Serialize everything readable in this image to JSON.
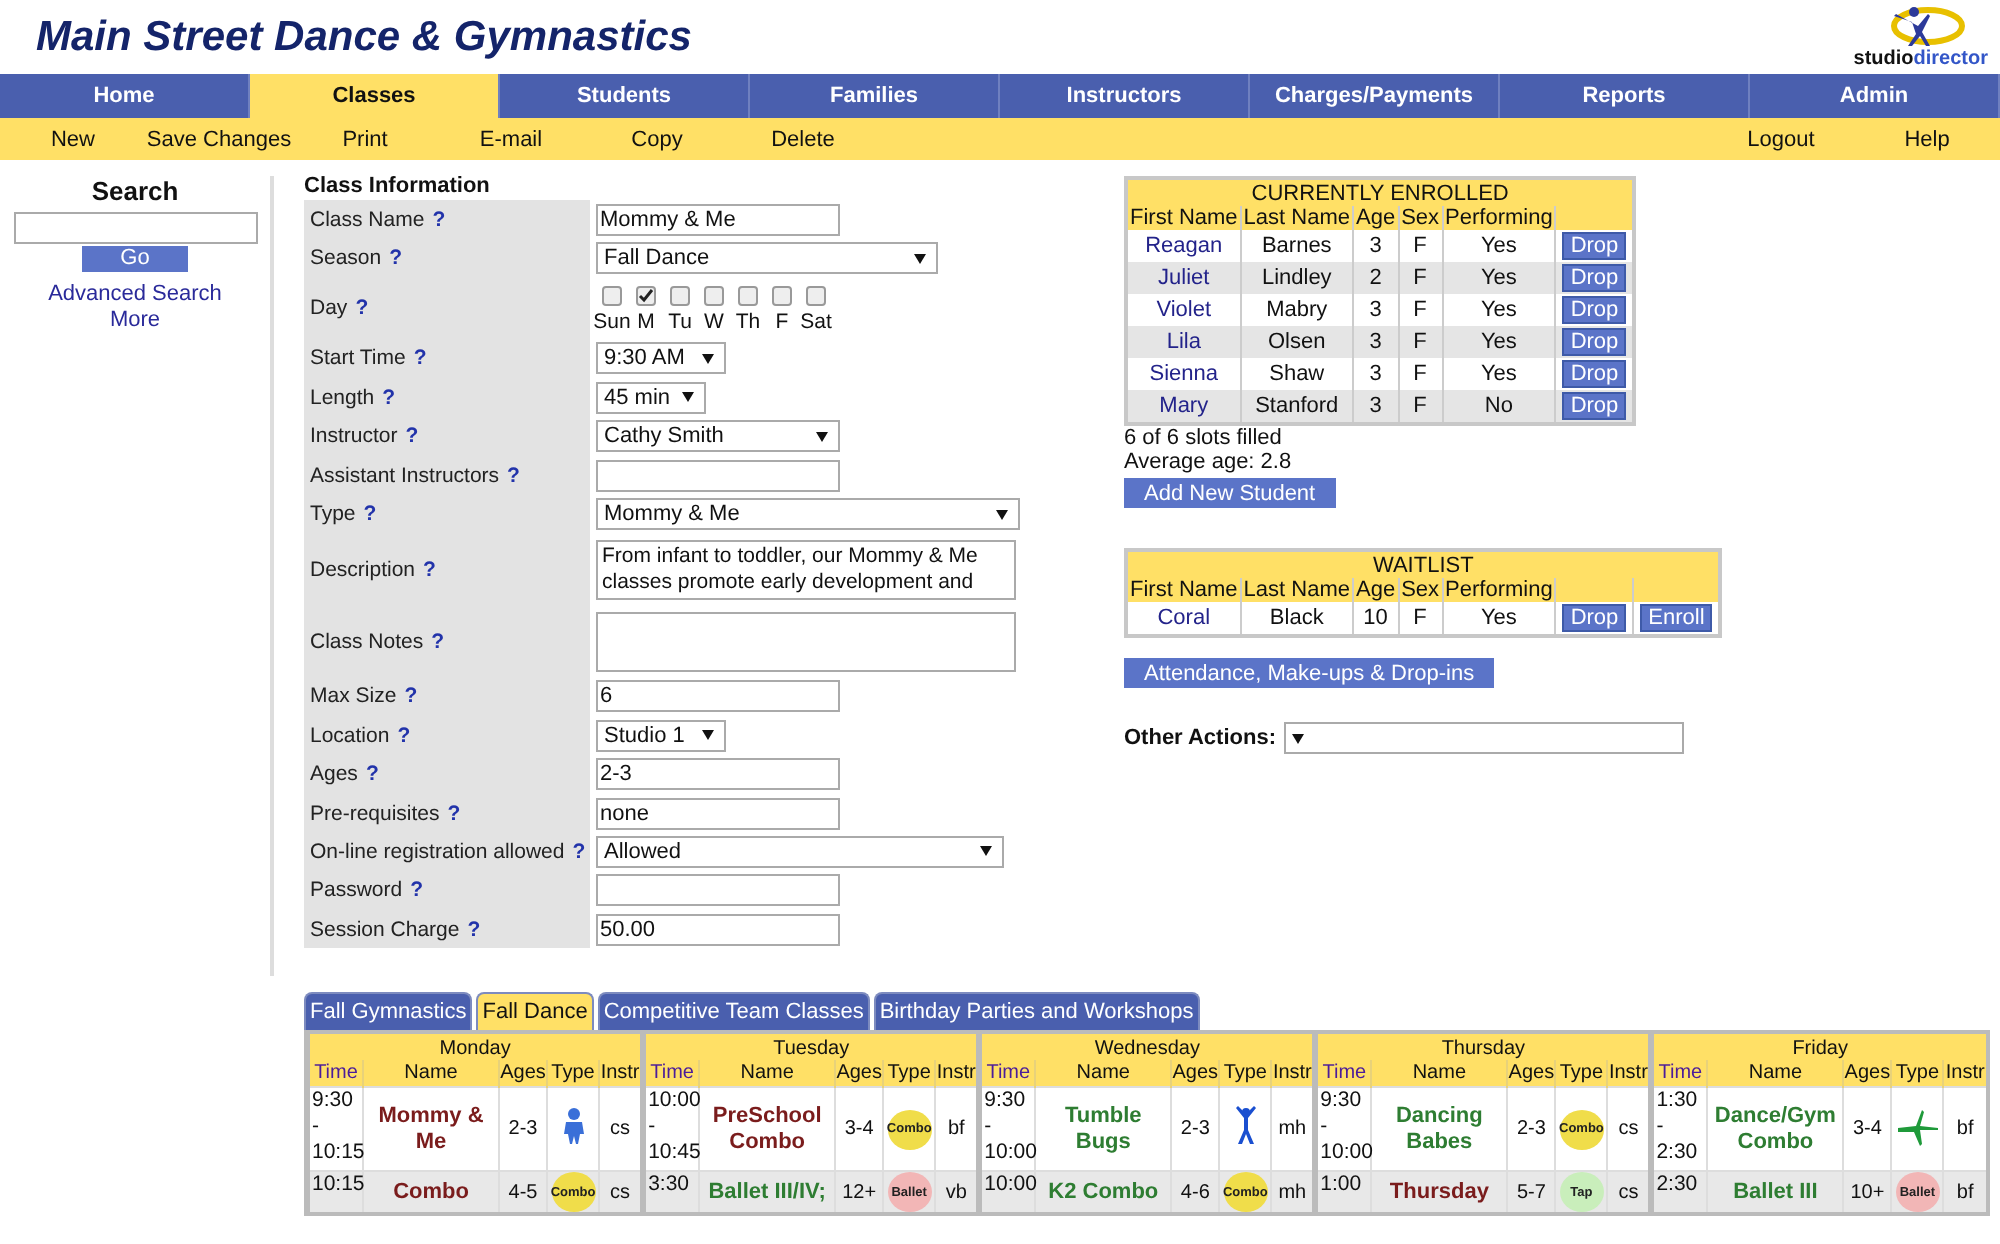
{
  "header": {
    "title": "Main Street Dance & Gymnastics",
    "logo_parts": [
      "studio",
      "director"
    ]
  },
  "nav": [
    {
      "label": "Home",
      "selected": false
    },
    {
      "label": "Classes",
      "selected": true
    },
    {
      "label": "Students",
      "selected": false
    },
    {
      "label": "Families",
      "selected": false
    },
    {
      "label": "Instructors",
      "selected": false
    },
    {
      "label": "Charges/Payments",
      "selected": false
    },
    {
      "label": "Reports",
      "selected": false
    },
    {
      "label": "Admin",
      "selected": false
    }
  ],
  "toolbar": {
    "left": [
      "New",
      "Save Changes",
      "Print",
      "E-mail",
      "Copy",
      "Delete"
    ],
    "right": [
      "Logout",
      "Help"
    ]
  },
  "search": {
    "title": "Search",
    "button": "Go",
    "links": [
      "Advanced Search",
      "More"
    ]
  },
  "class_info": {
    "title": "Class Information",
    "fields": [
      {
        "kind": "text",
        "label": "Class Name",
        "help": "?",
        "value": "Mommy & Me"
      },
      {
        "kind": "select",
        "label": "Season",
        "help": "?",
        "value": "Fall Dance"
      },
      {
        "kind": "days",
        "label": "Day",
        "help": "?",
        "days": [
          {
            "label": "Sun",
            "checked": false
          },
          {
            "label": "M",
            "checked": true
          },
          {
            "label": "Tu",
            "checked": false
          },
          {
            "label": "W",
            "checked": false
          },
          {
            "label": "Th",
            "checked": false
          },
          {
            "label": "F",
            "checked": false
          },
          {
            "label": "Sat",
            "checked": false
          }
        ]
      },
      {
        "kind": "select",
        "label": "Start Time",
        "help": "?",
        "value": "9:30 AM"
      },
      {
        "kind": "select",
        "label": "Length",
        "help": "?",
        "value": "45 min"
      },
      {
        "kind": "select",
        "label": "Instructor",
        "help": "?",
        "value": "Cathy Smith"
      },
      {
        "kind": "text",
        "label": "Assistant Instructors",
        "help": "?"
      },
      {
        "kind": "select",
        "label": "Type",
        "help": "?",
        "value": "Mommy & Me"
      },
      {
        "kind": "textarea",
        "label": "Description",
        "help": "?",
        "value": "From infant to toddler, our Mommy & Me classes promote early development and"
      },
      {
        "kind": "textarea",
        "label": "Class Notes",
        "help": "?"
      },
      {
        "kind": "text",
        "label": "Max Size",
        "help": "?",
        "value": "6"
      },
      {
        "kind": "select",
        "label": "Location",
        "help": "?",
        "value": "Studio 1"
      },
      {
        "kind": "text",
        "label": "Ages",
        "help": "?",
        "value": "2-3"
      },
      {
        "kind": "text",
        "label": "Pre-requisites",
        "help": "?",
        "value": "none"
      },
      {
        "kind": "select",
        "label": "On-line registration allowed",
        "help": "?",
        "value": "Allowed"
      },
      {
        "kind": "text",
        "label": "Password",
        "help": "?"
      },
      {
        "kind": "text",
        "label": "Session Charge",
        "help": "?",
        "value": "50.00"
      }
    ]
  },
  "enrolled": {
    "title": "CURRENTLY ENROLLED",
    "columns": [
      "First Name",
      "Last Name",
      "Age",
      "Sex",
      "Performing"
    ],
    "rows": [
      {
        "first": "Reagan",
        "last": "Barnes",
        "age": "3",
        "sex": "F",
        "performing": "Yes",
        "actions": [
          "Drop"
        ]
      },
      {
        "first": "Juliet",
        "last": "Lindley",
        "age": "2",
        "sex": "F",
        "performing": "Yes",
        "actions": [
          "Drop"
        ]
      },
      {
        "first": "Violet",
        "last": "Mabry",
        "age": "3",
        "sex": "F",
        "performing": "Yes",
        "actions": [
          "Drop"
        ]
      },
      {
        "first": "Lila",
        "last": "Olsen",
        "age": "3",
        "sex": "F",
        "performing": "Yes",
        "actions": [
          "Drop"
        ]
      },
      {
        "first": "Sienna",
        "last": "Shaw",
        "age": "3",
        "sex": "F",
        "performing": "Yes",
        "actions": [
          "Drop"
        ]
      },
      {
        "first": "Mary",
        "last": "Stanford",
        "age": "3",
        "sex": "F",
        "performing": "No",
        "actions": [
          "Drop"
        ]
      }
    ],
    "summary": [
      "6 of 6 slots filled",
      "Average age: 2.8"
    ],
    "add_button": "Add New Student"
  },
  "waitlist": {
    "title": "WAITLIST",
    "columns": [
      "First Name",
      "Last Name",
      "Age",
      "Sex",
      "Performing"
    ],
    "rows": [
      {
        "first": "Coral",
        "last": "Black",
        "age": "10",
        "sex": "F",
        "performing": "Yes",
        "actions": [
          "Drop",
          "Enroll"
        ]
      }
    ]
  },
  "attendance_button": "Attendance, Make-ups & Drop-ins",
  "other_actions": {
    "label": "Other Actions:"
  },
  "schedule": {
    "tabs": [
      {
        "label": "Fall Gymnastics",
        "selected": false
      },
      {
        "label": "Fall Dance",
        "selected": true
      },
      {
        "label": "Competitive Team Classes",
        "selected": false
      },
      {
        "label": "Birthday Parties and Workshops",
        "selected": false
      }
    ],
    "days": [
      {
        "day": "Monday",
        "columns": [
          "Time",
          "Name",
          "Ages",
          "Type",
          "Instr"
        ],
        "classes": [
          {
            "time": "9:30\n-\n10:15",
            "name": "Mommy & Me",
            "color": "#7a1c1c",
            "ages": "2-3",
            "type": {
              "kind": "toddler"
            },
            "instr": "cs"
          },
          {
            "time": "10:15",
            "name": "Combo",
            "color": "#7a1c1c",
            "ages": "4-5",
            "type": {
              "kind": "combo",
              "label": "Combo"
            },
            "instr": "cs"
          }
        ]
      },
      {
        "day": "Tuesday",
        "columns": [
          "Time",
          "Name",
          "Ages",
          "Type",
          "Instr"
        ],
        "classes": [
          {
            "time": "10:00\n-\n10:45",
            "name": "PreSchool Combo",
            "color": "#7a1c1c",
            "ages": "3-4",
            "type": {
              "kind": "combo",
              "label": "Combo"
            },
            "instr": "bf"
          },
          {
            "time": "3:30",
            "name": "Ballet III/IV;",
            "color": "#2e7d32",
            "ages": "12+",
            "type": {
              "kind": "ballet",
              "label": "Ballet"
            },
            "instr": "vb"
          }
        ]
      },
      {
        "day": "Wednesday",
        "columns": [
          "Time",
          "Name",
          "Ages",
          "Type",
          "Instr"
        ],
        "classes": [
          {
            "time": "9:30\n-\n10:00",
            "name": "Tumble Bugs",
            "color": "#2e7d32",
            "ages": "2-3",
            "type": {
              "kind": "jumper"
            },
            "instr": "mh"
          },
          {
            "time": "10:00",
            "name": "K2 Combo",
            "color": "#2e7d32",
            "ages": "4-6",
            "type": {
              "kind": "combo",
              "label": "Combo"
            },
            "instr": "mh"
          }
        ]
      },
      {
        "day": "Thursday",
        "columns": [
          "Time",
          "Name",
          "Ages",
          "Type",
          "Instr"
        ],
        "classes": [
          {
            "time": "9:30\n-\n10:00",
            "name": "Dancing Babes",
            "color": "#2e7d32",
            "ages": "2-3",
            "type": {
              "kind": "combo",
              "label": "Combo"
            },
            "instr": "cs"
          },
          {
            "time": "1:00",
            "name": "Thursday",
            "color": "#7a1c1c",
            "ages": "5-7",
            "type": {
              "kind": "tap",
              "label": "Tap"
            },
            "instr": "cs"
          }
        ]
      },
      {
        "day": "Friday",
        "columns": [
          "Time",
          "Name",
          "Ages",
          "Type",
          "Instr"
        ],
        "classes": [
          {
            "time": "1:30\n-\n2:30",
            "name": "Dance/Gym Combo",
            "color": "#2e7d32",
            "ages": "3-4",
            "type": {
              "kind": "leaper"
            },
            "instr": "bf"
          },
          {
            "time": "2:30",
            "name": "Ballet III",
            "color": "#2e7d32",
            "ages": "10+",
            "type": {
              "kind": "ballet",
              "label": "Ballet"
            },
            "instr": "bf"
          }
        ]
      }
    ]
  }
}
